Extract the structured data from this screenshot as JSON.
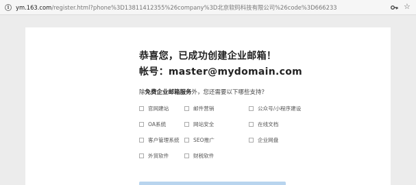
{
  "browser": {
    "url_host": "ym.163.com",
    "url_rest": "/register.html?phone%3D13811412355%26company%3D北京软码科技有限公司%26code%3D666233"
  },
  "page": {
    "title_line1": "恭喜您，已成功创建企业邮箱！",
    "title_line2": "帐号：master@mydomain.com",
    "question_prefix": "除",
    "question_bold": "免费企业邮箱服务",
    "question_suffix": "外，您还需要以下哪些支持？",
    "options": [
      {
        "label": "官网建站",
        "checked": false
      },
      {
        "label": "邮件营销",
        "checked": false
      },
      {
        "label": "公众号/小程序建设",
        "checked": false
      },
      {
        "label": "OA系统",
        "checked": false
      },
      {
        "label": "网站安全",
        "checked": false
      },
      {
        "label": "在线文档",
        "checked": false
      },
      {
        "label": "客户管理系统",
        "checked": false
      },
      {
        "label": "SEO推广",
        "checked": false
      },
      {
        "label": "企业网盘",
        "checked": false
      },
      {
        "label": "外贸软件",
        "checked": false
      },
      {
        "label": "财税软件",
        "checked": false
      }
    ]
  }
}
